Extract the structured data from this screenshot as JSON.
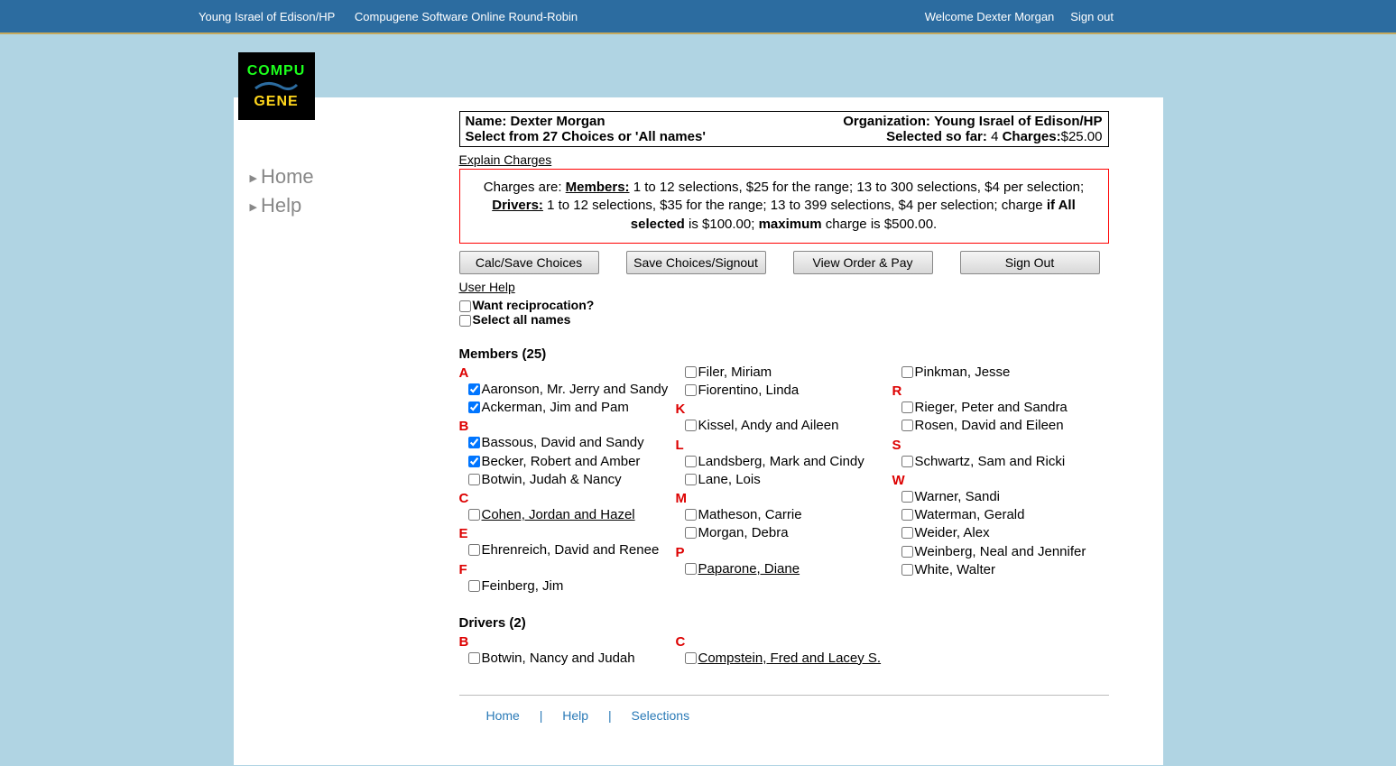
{
  "topbar": {
    "org": "Young Israel of Edison/HP",
    "app": "Compugene Software Online Round-Robin",
    "welcome": "Welcome Dexter Morgan",
    "signout": "Sign out"
  },
  "logo": {
    "l1": "COMPU",
    "l3": "GENE"
  },
  "sidebar": {
    "home": "Home",
    "help": "Help"
  },
  "info": {
    "name_label": "Name:",
    "name_value": "Dexter Morgan",
    "org_label": "Organization:",
    "org_value": "Young Israel of Edison/HP",
    "select_from": "Select from 27 Choices or 'All names'",
    "selected_label": "Selected so far:",
    "selected_value": "4",
    "charges_label": "Charges:",
    "charges_value": "$25.00"
  },
  "explain": "Explain Charges",
  "charges_text": {
    "prefix": "Charges are:  ",
    "members_label": "Members:",
    "members_text": " 1 to 12 selections, $25 for the range; 13 to 300 selections, $4 per selection; ",
    "drivers_label": "Drivers:",
    "drivers_text": " 1 to 12 selections, $35 for the range; 13 to 399 selections, $4 per selection; charge ",
    "ifall": "if All selected",
    "ifall_rest": " is $100.00; ",
    "max": "maximum",
    "max_rest": " charge is $500.00."
  },
  "buttons": {
    "calc": "Calc/Save Choices",
    "save": "Save Choices/Signout",
    "view": "View Order & Pay",
    "signout": "Sign Out"
  },
  "user_help": "User Help",
  "options": {
    "recip": "Want reciprocation?",
    "selectall": "Select all names"
  },
  "members_title": "Members (25)",
  "members": {
    "col1": [
      {
        "type": "letter",
        "text": "A"
      },
      {
        "type": "item",
        "text": "Aaronson, Mr. Jerry and Sandy",
        "checked": true
      },
      {
        "type": "item",
        "text": "Ackerman, Jim and Pam",
        "checked": true
      },
      {
        "type": "letter",
        "text": "B"
      },
      {
        "type": "item",
        "text": "Bassous, David and Sandy",
        "checked": true
      },
      {
        "type": "item",
        "text": "Becker, Robert and Amber",
        "checked": true
      },
      {
        "type": "item",
        "text": "Botwin, Judah & Nancy",
        "checked": false
      },
      {
        "type": "letter",
        "text": "C"
      },
      {
        "type": "item",
        "text": "Cohen, Jordan and Hazel",
        "checked": false,
        "underline": true
      },
      {
        "type": "letter",
        "text": "E"
      },
      {
        "type": "item",
        "text": "Ehrenreich, David and Renee",
        "checked": false
      },
      {
        "type": "letter",
        "text": "F"
      },
      {
        "type": "item",
        "text": "Feinberg, Jim",
        "checked": false
      }
    ],
    "col2": [
      {
        "type": "item",
        "text": "Filer, Miriam",
        "checked": false
      },
      {
        "type": "item",
        "text": "Fiorentino, Linda",
        "checked": false
      },
      {
        "type": "letter",
        "text": "K"
      },
      {
        "type": "item",
        "text": "Kissel, Andy and Aileen",
        "checked": false
      },
      {
        "type": "letter",
        "text": "L"
      },
      {
        "type": "item",
        "text": "Landsberg, Mark and Cindy",
        "checked": false
      },
      {
        "type": "item",
        "text": "Lane, Lois",
        "checked": false
      },
      {
        "type": "letter",
        "text": "M"
      },
      {
        "type": "item",
        "text": "Matheson, Carrie",
        "checked": false
      },
      {
        "type": "item",
        "text": "Morgan, Debra",
        "checked": false
      },
      {
        "type": "letter",
        "text": "P"
      },
      {
        "type": "item",
        "text": "Paparone, Diane",
        "checked": false,
        "underline": true
      }
    ],
    "col3": [
      {
        "type": "item",
        "text": "Pinkman, Jesse",
        "checked": false
      },
      {
        "type": "letter",
        "text": "R"
      },
      {
        "type": "item",
        "text": "Rieger, Peter and Sandra",
        "checked": false
      },
      {
        "type": "item",
        "text": "Rosen, David and Eileen",
        "checked": false
      },
      {
        "type": "letter",
        "text": "S"
      },
      {
        "type": "item",
        "text": "Schwartz, Sam and Ricki",
        "checked": false
      },
      {
        "type": "letter",
        "text": "W"
      },
      {
        "type": "item",
        "text": "Warner, Sandi",
        "checked": false
      },
      {
        "type": "item",
        "text": "Waterman, Gerald",
        "checked": false
      },
      {
        "type": "item",
        "text": "Weider, Alex",
        "checked": false
      },
      {
        "type": "item",
        "text": "Weinberg, Neal and Jennifer",
        "checked": false
      },
      {
        "type": "item",
        "text": "White, Walter",
        "checked": false
      }
    ]
  },
  "drivers_title": "Drivers (2)",
  "drivers": {
    "col1": [
      {
        "type": "letter",
        "text": "B"
      },
      {
        "type": "item",
        "text": "Botwin, Nancy and Judah",
        "checked": false
      }
    ],
    "col2": [
      {
        "type": "letter",
        "text": "C"
      },
      {
        "type": "item",
        "text": "Compstein, Fred and Lacey S.",
        "checked": false,
        "underline": true
      }
    ],
    "col3": []
  },
  "footer": {
    "home": "Home",
    "help": "Help",
    "selections": "Selections"
  }
}
